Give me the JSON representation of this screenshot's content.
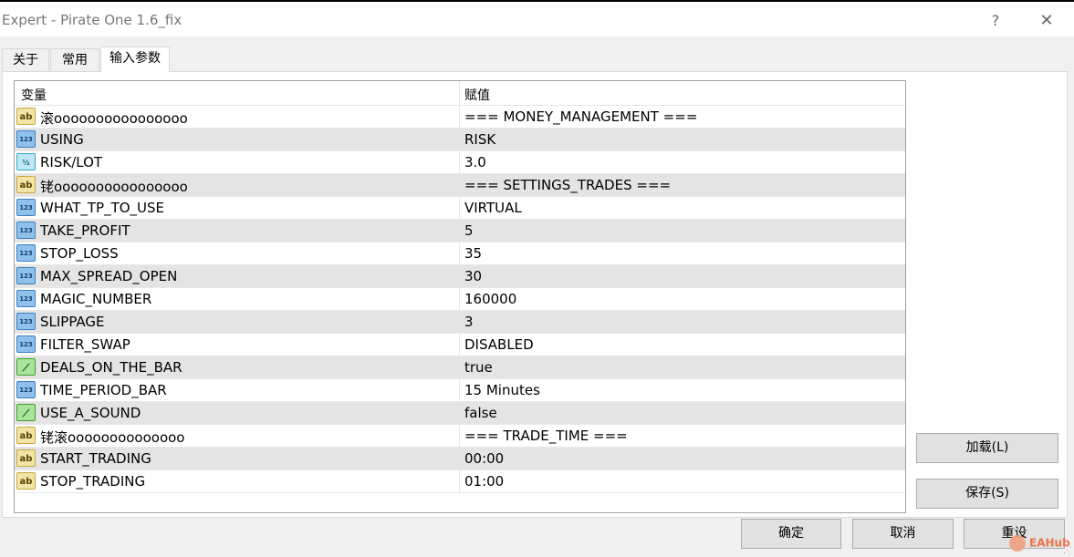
{
  "window": {
    "title": "Expert - Pirate One 1.6_fix",
    "help_glyph": "?",
    "close_glyph": "✕"
  },
  "tabs": [
    {
      "label": "关于"
    },
    {
      "label": "常用"
    },
    {
      "label": "输入参数",
      "active": true
    }
  ],
  "grid": {
    "columns": [
      "变量",
      "赋值"
    ],
    "rows": [
      {
        "type": "string",
        "icon_label": "ab",
        "name": "滚oooooooooooooooo",
        "value": "=== MONEY_MANAGEMENT ==="
      },
      {
        "type": "int",
        "icon_label": "123",
        "name": "USING",
        "value": "RISK"
      },
      {
        "type": "double",
        "icon_label": "½",
        "name": "RISK/LOT",
        "value": "3.0"
      },
      {
        "type": "string",
        "icon_label": "ab",
        "name": "铑oooooooooooooooo",
        "value": "=== SETTINGS_TRADES ==="
      },
      {
        "type": "int",
        "icon_label": "123",
        "name": "WHAT_TP_TO_USE",
        "value": "VIRTUAL"
      },
      {
        "type": "int",
        "icon_label": "123",
        "name": "TAKE_PROFIT",
        "value": "5"
      },
      {
        "type": "int",
        "icon_label": "123",
        "name": "STOP_LOSS",
        "value": "35"
      },
      {
        "type": "int",
        "icon_label": "123",
        "name": "MAX_SPREAD_OPEN",
        "value": "30"
      },
      {
        "type": "int",
        "icon_label": "123",
        "name": "MAGIC_NUMBER",
        "value": "160000"
      },
      {
        "type": "int",
        "icon_label": "123",
        "name": "SLIPPAGE",
        "value": "3"
      },
      {
        "type": "int",
        "icon_label": "123",
        "name": "FILTER_SWAP",
        "value": "DISABLED"
      },
      {
        "type": "bool",
        "icon_label": "⟋",
        "name": "DEALS_ON_THE_BAR",
        "value": "true"
      },
      {
        "type": "int",
        "icon_label": "123",
        "name": "TIME_PERIOD_BAR",
        "value": "15 Minutes"
      },
      {
        "type": "bool",
        "icon_label": "⟋",
        "name": "USE_A_SOUND",
        "value": "false"
      },
      {
        "type": "string",
        "icon_label": "ab",
        "name": "铑滚oooooooooooooo",
        "value": "=== TRADE_TIME ==="
      },
      {
        "type": "string",
        "icon_label": "ab",
        "name": "START_TRADING",
        "value": "00:00"
      },
      {
        "type": "string",
        "icon_label": "ab",
        "name": "STOP_TRADING",
        "value": "01:00"
      }
    ]
  },
  "buttons": {
    "load": "加载(L)",
    "save": "保存(S)",
    "ok": "确定",
    "cancel": "取消",
    "reset": "重设"
  },
  "watermark": "EAHub",
  "colors": {
    "alt_row": "#e4e4e4",
    "string_icon": "#f2e4a8",
    "int_icon": "#8fc1ea",
    "double_icon": "#bfe7f3",
    "bool_icon": "#a9e39d"
  }
}
